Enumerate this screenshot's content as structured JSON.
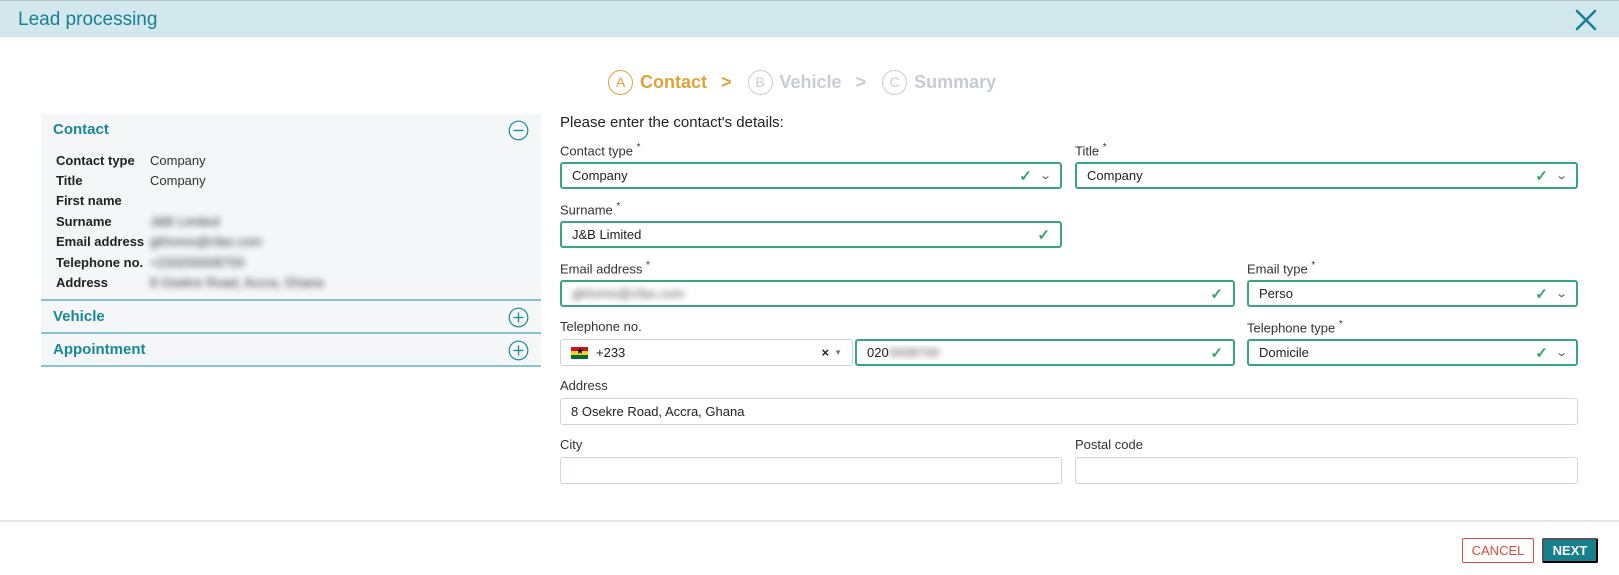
{
  "window": {
    "title": "Lead processing"
  },
  "stepper": [
    {
      "letter": "A",
      "label": "Contact"
    },
    {
      "letter": "B",
      "label": "Vehicle"
    },
    {
      "letter": "C",
      "label": "Summary"
    }
  ],
  "stepper_separator": ">",
  "sidebar": {
    "contact": {
      "title": "Contact",
      "rows": [
        {
          "key": "Contact type",
          "value": "Company"
        },
        {
          "key": "Title",
          "value": "Company"
        },
        {
          "key": "First name",
          "value": ""
        },
        {
          "key": "Surname",
          "value": "J&B Limited"
        },
        {
          "key": "Email address",
          "value": "gkhomo@cfao.com"
        },
        {
          "key": "Telephone no.",
          "value": "+233200008700"
        },
        {
          "key": "Address",
          "value": "8 Osekre Road, Accra, Ghana"
        }
      ]
    },
    "vehicle": {
      "title": "Vehicle"
    },
    "appointment": {
      "title": "Appointment"
    }
  },
  "form": {
    "intro": "Please enter the contact's details:",
    "contact_type": {
      "label": "Contact type",
      "required": "*",
      "value": "Company"
    },
    "title": {
      "label": "Title",
      "required": "*",
      "value": "Company"
    },
    "surname": {
      "label": "Surname",
      "required": "*",
      "value": "J&B Limited"
    },
    "email": {
      "label": "Email address",
      "required": "*",
      "value": "gkhomo@cfao.com"
    },
    "email_type": {
      "label": "Email type",
      "required": "*",
      "value": "Perso"
    },
    "telephone": {
      "label": "Telephone no.",
      "country_code": "+233",
      "clear": "×",
      "prefix": "020",
      "rest": "0008700"
    },
    "telephone_type": {
      "label": "Telephone type",
      "required": "*",
      "value": "Domicile"
    },
    "address": {
      "label": "Address",
      "value": "8 Osekre Road, Accra, Ghana"
    },
    "city": {
      "label": "City",
      "value": ""
    },
    "postal_code": {
      "label": "Postal code",
      "value": ""
    }
  },
  "footer": {
    "cancel_label": "CANCEL",
    "next_label": "NEXT"
  },
  "icons": {
    "close": "close-icon",
    "collapse": "minus-circle-icon",
    "expand": "plus-circle-icon",
    "check": "check-icon",
    "chevron": "chevron-down-icon",
    "flag": "ghana-flag-icon"
  },
  "colors": {
    "accent": "#1a8797",
    "active_step": "#e0a33b",
    "valid": "#3aa67d",
    "cancel": "#e14b3c",
    "next": "#187f8d",
    "titlebar": "#d3e8ec"
  }
}
